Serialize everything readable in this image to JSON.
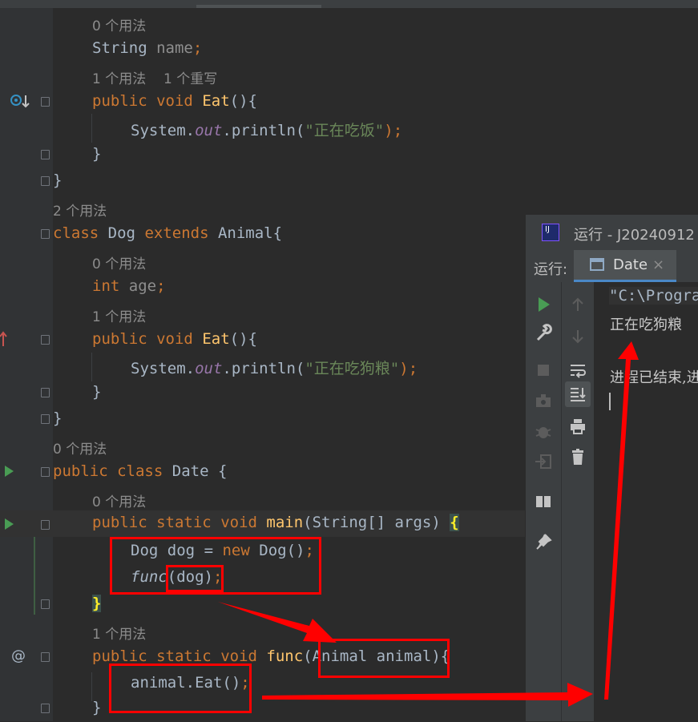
{
  "editor": {
    "lines": [
      {
        "hint": "0 个用法"
      },
      {
        "field_type": "String",
        "field_name": "name",
        "semi": ";"
      },
      {
        "hint_a": "1 个用法",
        "hint_b": "1 个重写"
      },
      {
        "kw1": "public",
        "kw2": "void",
        "method": "Eat",
        "rest": "(){"
      },
      {
        "obj": "System.",
        "fld": "out",
        "call": ".println(",
        "str": "\"正在吃饭\"",
        "end": ");"
      },
      {
        "text": "}"
      },
      {
        "text": "}"
      },
      {
        "hint": "2 个用法"
      },
      {
        "kw1": "class",
        "name": "Dog",
        "kw2": "extends",
        "parent": "Animal{"
      },
      {
        "hint": "0 个用法"
      },
      {
        "kw1": "int",
        "field_name": "age",
        "semi": ";"
      },
      {
        "hint": "1 个用法"
      },
      {
        "kw1": "public",
        "kw2": "void",
        "method": "Eat",
        "rest": "(){"
      },
      {
        "obj": "System.",
        "fld": "out",
        "call": ".println(",
        "str": "\"正在吃狗粮\"",
        "end": ");"
      },
      {
        "text": "}"
      },
      {
        "text": "}"
      },
      {
        "hint": "0 个用法"
      },
      {
        "kw1": "public",
        "kw2": "class",
        "name": "Date",
        "rest": "{"
      },
      {
        "hint": "0 个用法"
      },
      {
        "kw1": "public",
        "kw2": "static",
        "kw3": "void",
        "method": "main",
        "params": "(String[] args)",
        "brace": "{"
      },
      {
        "type": "Dog",
        "var": "dog",
        "eq": "=",
        "kw1": "new",
        "ctor": "Dog()",
        "semi": ";"
      },
      {
        "fn": "func",
        "args": "(dog)",
        "semi": ";"
      },
      {
        "brace": "}"
      },
      {
        "hint": "1 个用法"
      },
      {
        "kw1": "public",
        "kw2": "static",
        "kw3": "void",
        "method": "func",
        "params": "(Animal animal)",
        "rest": "{"
      },
      {
        "stmt": "animal.Eat()",
        "semi": ";"
      },
      {
        "text": "}"
      }
    ]
  },
  "run_panel": {
    "title": "运行 - J20240912",
    "label": "运行:",
    "tab": "Date",
    "console": [
      "\"C:\\Progra",
      "正在吃狗粮",
      "",
      "进程已结束,进"
    ]
  },
  "colors": {
    "keyword": "#cc7832",
    "method": "#ffc66d",
    "string": "#6a8759",
    "annotation": "#ff0000",
    "run": "#499c54"
  }
}
